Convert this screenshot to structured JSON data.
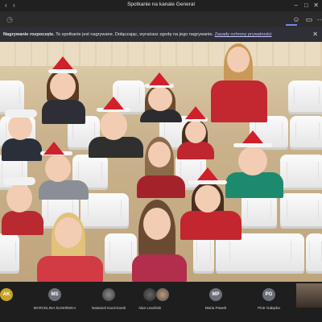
{
  "window": {
    "title": "Spotkanie na kanale General"
  },
  "banner": {
    "bold": "Nagrywanie rozpoczęte.",
    "text": "To spotkanie jest nagrywane. Dołączając, wyrażasz zgodę na jego nagrywanie.",
    "link": "Zasady ochrony prywatności"
  },
  "participants": [
    {
      "initials": "AK",
      "name": "",
      "color": "#c9a227"
    },
    {
      "initials": "MS",
      "name": "MARCELINA ŚLIWIŃSKA",
      "color": "#6b6f78"
    },
    {
      "initials": "",
      "name": "Natasnel Kaczmarek",
      "color": "#555555"
    },
    {
      "initials": "",
      "name": "Alan Lewiński",
      "color": "#4a4a4a"
    },
    {
      "initials": "",
      "name": "Maria Pawek",
      "color": "#6a5a50"
    },
    {
      "initials": "MP",
      "name": "Maria Pawek",
      "color": "#6b6f78"
    },
    {
      "initials": "PG",
      "name": "Piotr Gałązka",
      "color": "#6b6f78"
    }
  ],
  "colors": {
    "accent": "#c5c7ff",
    "hat": "#d0202a",
    "chair": "#f4f4f4"
  }
}
